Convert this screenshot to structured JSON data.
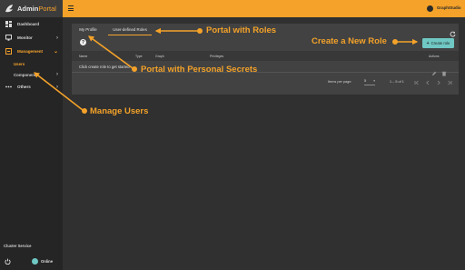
{
  "brand": {
    "name_bold": "Admin",
    "name_accent": "Portal"
  },
  "sidebar": {
    "items": [
      {
        "label": "Dashboard",
        "icon": "dashboard-icon"
      },
      {
        "label": "Monitor",
        "icon": "monitor-icon",
        "chevron": "›"
      },
      {
        "label": "Management",
        "icon": "management-icon",
        "chevron": "⌄"
      }
    ],
    "sub_items": [
      {
        "label": "Users"
      },
      {
        "label": "Components",
        "chevron": "›"
      }
    ],
    "others": {
      "label": "Others",
      "chevron": "›"
    },
    "cluster_service": {
      "label": "Cluster Service",
      "status": "Online",
      "status_color": "#6fc8c3"
    }
  },
  "header": {
    "user_name": "GraphStudio"
  },
  "tabs": [
    {
      "label": "My Profile"
    },
    {
      "label": "User-defined Roles"
    }
  ],
  "toolbar": {
    "help_label": "?",
    "create_plus": "+",
    "create_label": "Create role"
  },
  "table": {
    "columns": [
      "Name",
      "Type",
      "Graph",
      "Privileges",
      "Actions"
    ],
    "empty_message": "Click create role to get started"
  },
  "paginator": {
    "items_per_page_label": "Items per page:",
    "page_size": "5",
    "range": "1 – 5 of 1"
  },
  "annotations": {
    "portal_roles": "Portal with Roles",
    "create_role": "Create a New Role",
    "personal_secrets": "Portal with Personal Secrets",
    "manage_users": "Manage Users"
  },
  "colors": {
    "accent": "#f4a229",
    "teal": "#6fc8c3",
    "background": "#303030",
    "sidebar": "#252525",
    "panel": "#424242"
  }
}
